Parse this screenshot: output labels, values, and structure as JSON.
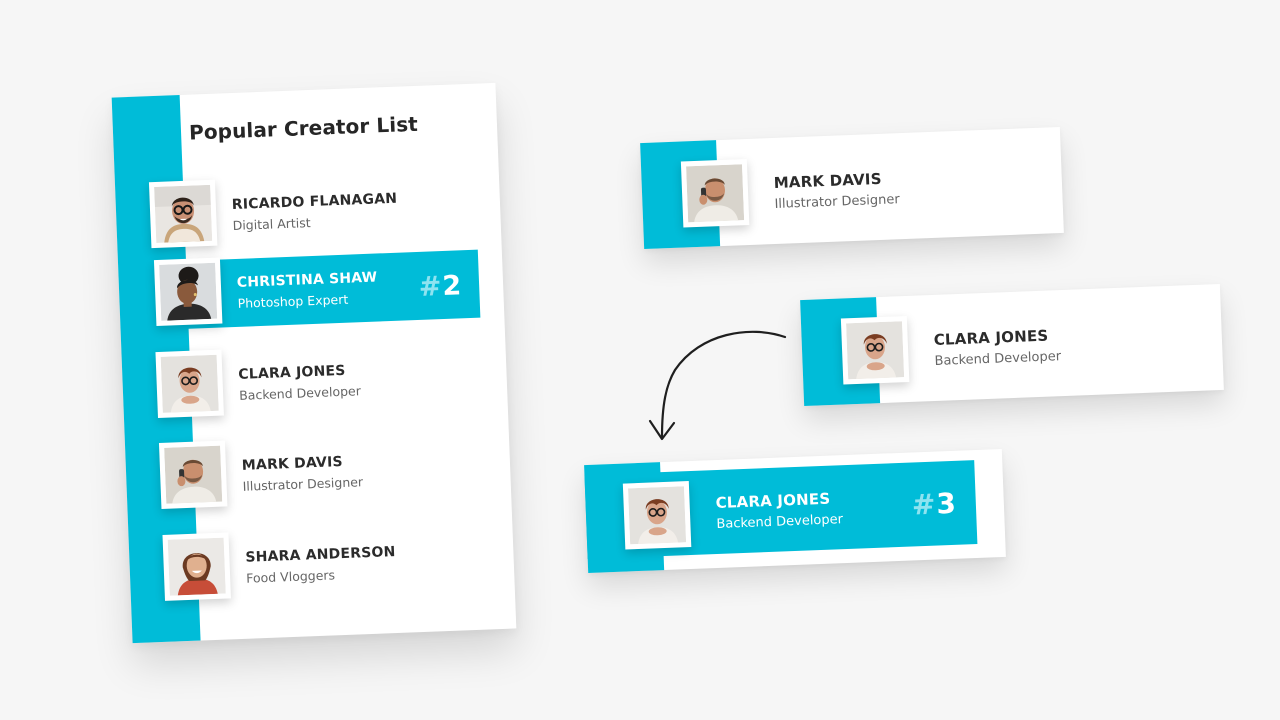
{
  "colors": {
    "accent": "#00bcd8",
    "title": "#262626",
    "text": "#2b2b2b",
    "muted": "#666666"
  },
  "list_card": {
    "title": "Popular Creator List",
    "items": [
      {
        "name": "RICARDO FLANAGAN",
        "role": "Digital Artist",
        "avatar": "ricardo-photo"
      },
      {
        "name": "CHRISTINA SHAW",
        "role": "Photoshop Expert",
        "avatar": "christina-photo",
        "rank_hash": "#",
        "rank_number": "2"
      },
      {
        "name": "CLARA JONES",
        "role": "Backend Developer",
        "avatar": "clara-photo"
      },
      {
        "name": "MARK DAVIS",
        "role": "Illustrator Designer",
        "avatar": "mark-photo"
      },
      {
        "name": "SHARA ANDERSON",
        "role": "Food Vloggers",
        "avatar": "shara-photo"
      }
    ]
  },
  "floating_cards": {
    "mark": {
      "name": "MARK DAVIS",
      "role": "Illustrator Designer"
    },
    "clara": {
      "name": "CLARA JONES",
      "role": "Backend Developer"
    },
    "clara_ranked": {
      "name": "CLARA JONES",
      "role": "Backend Developer",
      "rank_hash": "#",
      "rank_number": "3"
    }
  },
  "icons": {
    "arrow": "curved-arrow-icon"
  }
}
